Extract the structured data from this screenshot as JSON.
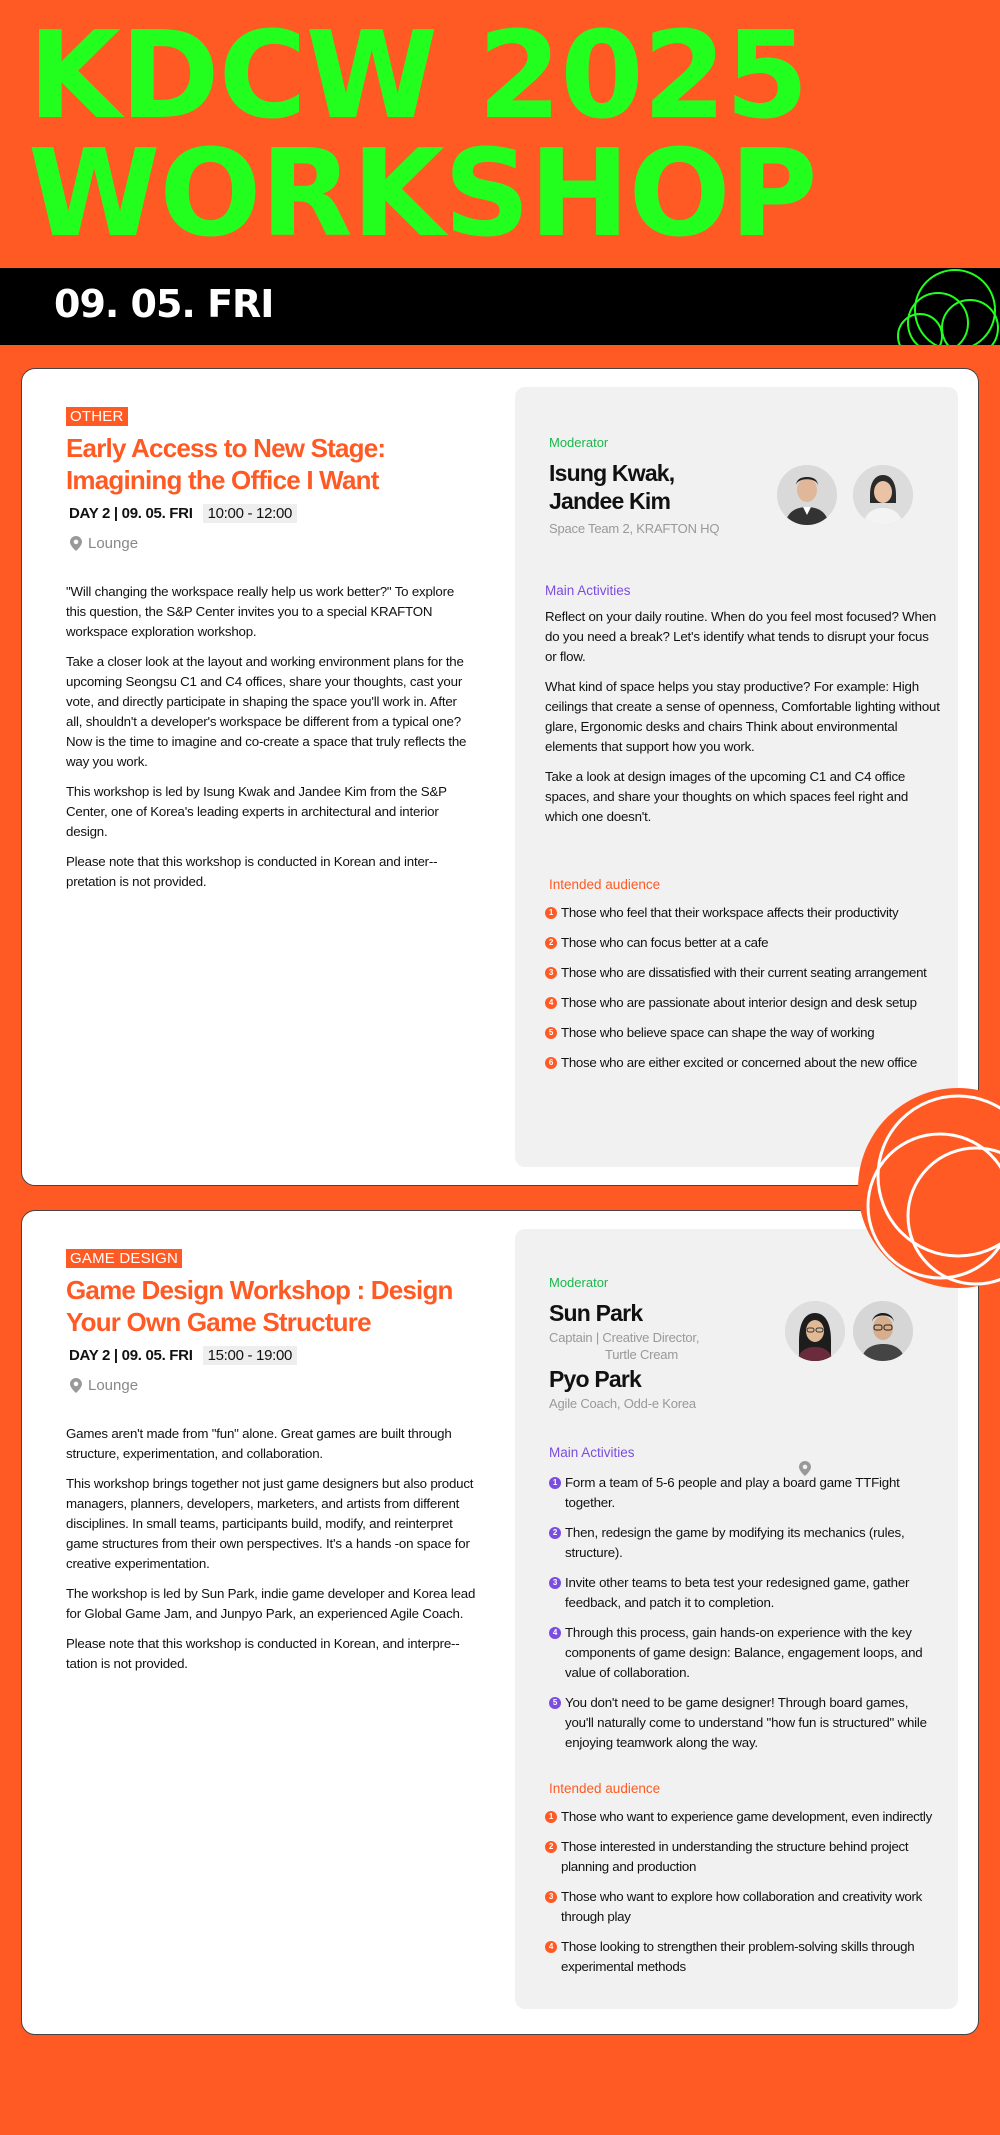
{
  "hero": {
    "line1": "KDCW 2025",
    "line2": "WORKSHOP",
    "date": "09. 05. FRI"
  },
  "colors": {
    "accent": "#ff5a24",
    "green": "#22ff1e",
    "purple": "#7b4ce0",
    "moderator": "#19b84c"
  },
  "workshop1": {
    "tag": "OTHER",
    "title": "Early Access to New Stage: Imagining the Office I Want",
    "day": "DAY 2 | 09. 05. FRI",
    "time": "10:00 - 12:00",
    "location": "Lounge",
    "desc": [
      "\"Will changing the workspace really help us work better?\" To explore this question, the S&P Center invites you to a special KRAFTON workspace exploration workshop.",
      "Take a closer look at the layout and working environment plans for the upcoming Seongsu C1 and C4 offices, share your thoughts, cast your vote, and directly participate in shaping the space you'll work in. After all, shouldn't a developer's workspace be different from a typical one? Now is the time to imagine and co-create a space that truly reflects the way you work.",
      "This workshop is led by Isung Kwak and Jandee Kim from the S&P Center, one of Korea's leading experts in architectural and interior design.",
      "Please note that this workshop is conducted in Korean and inter--pretation is not provided."
    ],
    "moderator_label": "Moderator",
    "moderator_name_1": "Isung Kwak,",
    "moderator_name_2": "Jandee Kim",
    "moderator_aff": "Space Team 2, KRAFTON HQ",
    "activities_label": "Main Activities",
    "activities": [
      "Reflect on your daily routine. When do you feel most focused? When do you need a break? Let's identify what tends to disrupt your focus or flow.",
      "What kind of space helps you stay productive? For example: High ceilings that create a sense of openness, Comfortable lighting without glare, Ergonomic desks and chairs Think about environmental elements that support how you work.",
      "Take a look at design images of the upcoming C1 and C4 office spaces, and share your thoughts on which spaces feel right and which one doesn't."
    ],
    "audience_label": "Intended audience",
    "audience": [
      "Those who feel that their workspace affects their productivity",
      "Those who can focus better at a cafe",
      "Those who are dissatisfied with their current seating arrangement",
      "Those who are passionate about interior design and desk setup",
      "Those who believe space can shape the way of working",
      "Those who are either excited or concerned about the new office"
    ]
  },
  "workshop2": {
    "tag": "GAME DESIGN",
    "title": "Game Design Workshop : Design Your Own Game Structure",
    "day": "DAY 2 | 09. 05. FRI",
    "time": "15:00 - 19:00",
    "location": "Lounge",
    "desc": [
      "Games aren't made from \"fun\" alone. Great games are built through structure, experimentation, and collaboration.",
      "This workshop brings together not just game designers but also product managers, planners, developers, marketers, and artists from different disciplines. In small teams, participants build, modify, and reinterpret game structures from their own perspectives. It's a hands -on space for creative experimentation.",
      "The workshop is led by Sun Park, indie game developer and Korea lead for Global Game Jam, and Junpyo Park, an experienced Agile Coach.",
      "Please note that this workshop is conducted in Korean, and interpre--tation is not provided."
    ],
    "moderator_label": "Moderator",
    "moderator1_name": "Sun Park",
    "moderator1_aff_1": "Captain | Creative Director,",
    "moderator1_aff_2": "Turtle Cream",
    "moderator2_name": "Pyo Park",
    "moderator2_aff": "Agile Coach, Odd-e Korea",
    "activities_label": "Main Activities",
    "activities": [
      "Form a team of 5-6 people and play a board game TTFight together.",
      "Then, redesign the game by modifying its mechanics (rules, structure).",
      "Invite other teams to beta test your redesigned game, gather feedback, and patch it to completion.",
      "Through this process, gain hands-on experience with the key components of game design: Balance, engagement loops, and value of collaboration.",
      "You don't need to be game designer! Through board games, you'll naturally come to understand \"how fun is structured\" while enjoying teamwork along the way."
    ],
    "audience_label": "Intended audience",
    "audience": [
      "Those who want to experience game development, even indirectly",
      "Those interested in understanding the structure behind project planning and production",
      "Those who want to explore how collaboration and creativity work through play",
      "Those looking to strengthen their problem-solving skills through experimental methods"
    ]
  }
}
